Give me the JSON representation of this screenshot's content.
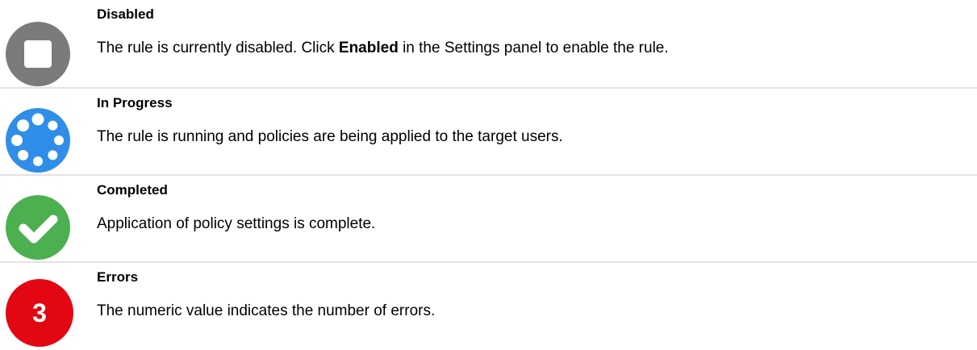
{
  "colors": {
    "disabled": "#7b7b7b",
    "in_progress": "#2f8ee8",
    "completed": "#4caf50",
    "errors": "#e30613",
    "divider": "#e3e3e3"
  },
  "statuses": [
    {
      "icon": "stop-square-icon",
      "title": "Disabled",
      "desc_before": "The rule is currently disabled. Click ",
      "desc_bold": "Enabled",
      "desc_after": " in the Settings panel to enable the rule."
    },
    {
      "icon": "spinner-dots-icon",
      "title": "In Progress",
      "desc": "The rule is running and policies are being applied to the target users."
    },
    {
      "icon": "checkmark-icon",
      "title": "Completed",
      "desc": "Application of policy settings is complete."
    },
    {
      "icon": "error-count-icon",
      "title": "Errors",
      "badge": "3",
      "desc": "The numeric value indicates the number of errors."
    }
  ]
}
